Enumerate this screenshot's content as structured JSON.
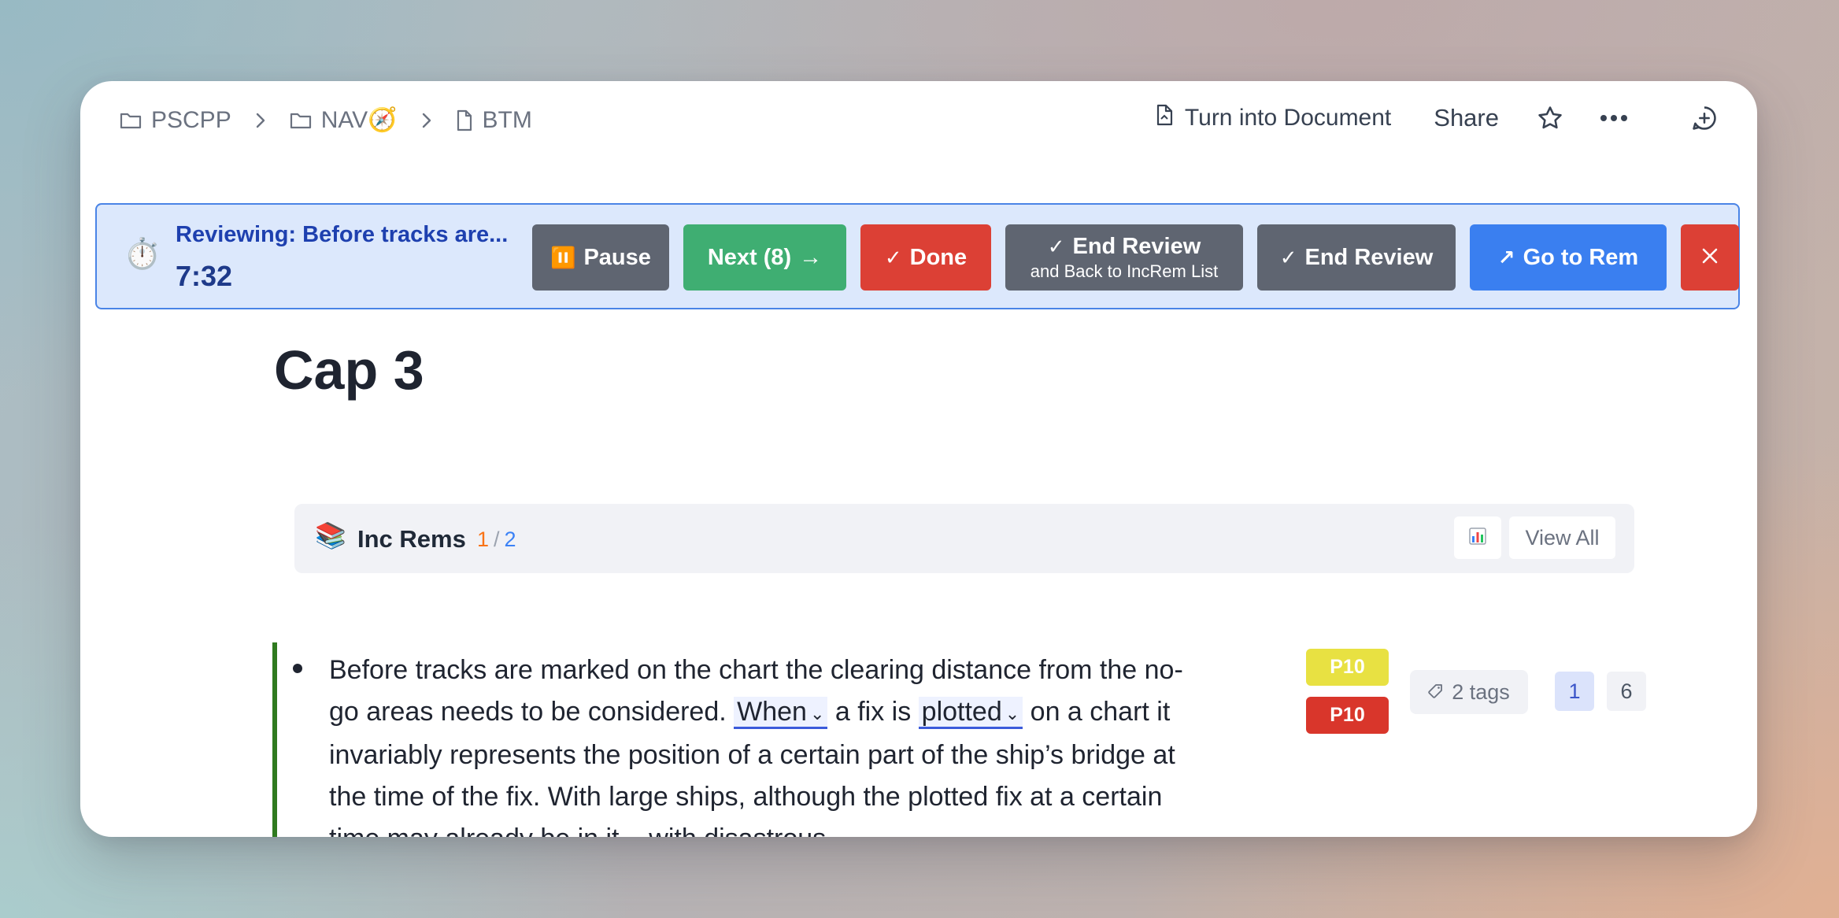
{
  "breadcrumb": [
    {
      "label": "PSCPP",
      "icon": "folder-icon"
    },
    {
      "label": "NAV🧭",
      "icon": "folder-icon"
    },
    {
      "label": "BTM",
      "icon": "document-icon"
    }
  ],
  "header": {
    "turn_into_document": "Turn into Document",
    "share": "Share"
  },
  "review": {
    "title": "Reviewing: Before tracks are...",
    "timer": "7:32",
    "pause_label": "Pause",
    "next_label": "Next (8)",
    "done_label": "Done",
    "end_back_label": "End Review",
    "end_back_sub": "and Back to IncRem List",
    "end_label": "End Review",
    "go_to_label": "Go to Rem",
    "colors": {
      "bar_bg": "#dce8fc",
      "bar_border": "#4a84e6",
      "gray": "#5f6571",
      "green": "#3fae72",
      "red": "#dc4035",
      "blue": "#3a7ff0"
    }
  },
  "page": {
    "title": "Cap 3"
  },
  "inc_rems": {
    "label": "Inc Rems",
    "current": "1",
    "separator": "/",
    "total": "2",
    "view_all": "View All"
  },
  "rem": {
    "text_before": "Before tracks are marked on the chart the clearing distance from the no-go areas needs to be considered.",
    "cloze_1": "When",
    "text_middle": "a fix is",
    "cloze_2": "plotted",
    "text_after": "on a chart it invariably represents the position of a certain part of the ship’s bridge at the time of the fix. With large ships, although the plotted fix at a certain time may already be in it – with disastrous",
    "priority_1": "P10",
    "priority_2": "P10",
    "tags": "2 tags",
    "badge_1": "1",
    "badge_2": "6",
    "colors": {
      "left_bar": "#2f7a1f",
      "priority_1_bg": "#e8e142",
      "priority_2_bg": "#d9362b"
    }
  }
}
